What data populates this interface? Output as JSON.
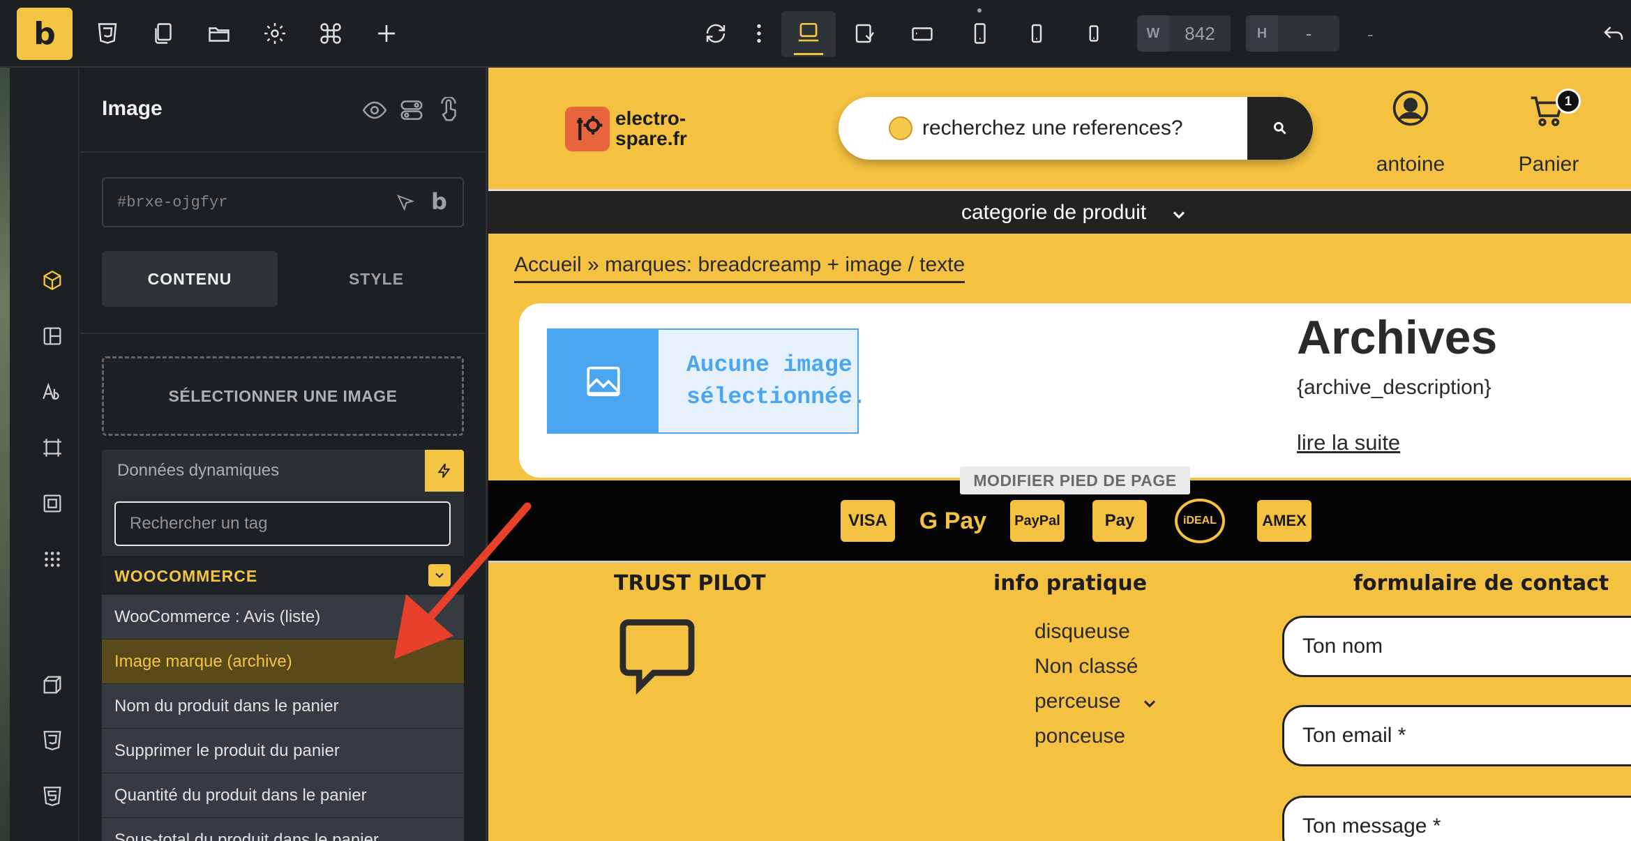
{
  "toolbar": {
    "logo": "b",
    "width_label": "W",
    "width_value": "842",
    "height_label": "H",
    "height_value": "-",
    "extra_value": "-"
  },
  "panel": {
    "title": "Image",
    "element_id": "#brxe-ojgfyr",
    "id_badge": "b",
    "tabs": {
      "content": "CONTENU",
      "style": "STYLE"
    },
    "select_image": "SÉLECTIONNER UNE IMAGE",
    "dynamic_data": "Données dynamiques",
    "tag_search_placeholder": "Rechercher un tag",
    "group": "WOOCOMMERCE",
    "items": [
      "WooCommerce : Avis (liste)",
      "Image marque (archive)",
      "Nom du produit dans le panier",
      "Supprimer le produit du panier",
      "Quantité du produit dans le panier",
      "Sous-total du produit dans le panier"
    ],
    "active_index": 1
  },
  "site": {
    "logo_text_1": "electro-",
    "logo_text_2": "spare.fr",
    "search_placeholder": "recherchez une references?",
    "account_label": "antoine",
    "cart_label": "Panier",
    "cart_count": "1",
    "category_menu": "categorie de produit",
    "breadcrumb": "Accueil » marques: breadcreamp + image / texte",
    "image_placeholder_line1": "Aucune image",
    "image_placeholder_line2": "sélectionnée.",
    "archive_title": "Archives",
    "archive_description": "{archive_description}",
    "read_more": "lire la suite",
    "edit_footer": "MODIFIER PIED DE PAGE",
    "payments": [
      "VISA",
      "G Pay",
      "PayPal",
      " Pay",
      "iDEAL",
      "AMEX"
    ],
    "footer_col1_title": "TRUST PILOT",
    "footer_col2_title": "info pratique",
    "footer_col3_title": "formulaire de contact",
    "categories": [
      "disqueuse",
      "Non classé",
      "perceuse",
      "ponceuse"
    ],
    "form": {
      "name": "Ton nom",
      "email": "Ton email *",
      "message": "Ton message *"
    }
  },
  "colors": {
    "accent": "#f4c542",
    "site_bg": "#f4c140",
    "arrow": "#e8402a",
    "placeholder_blue": "#4aa6f0"
  }
}
